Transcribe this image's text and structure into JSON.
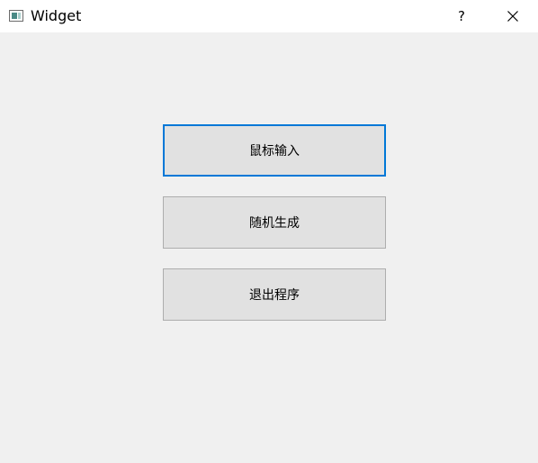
{
  "window": {
    "title": "Widget",
    "help_label": "?"
  },
  "buttons": [
    {
      "label": "鼠标输入"
    },
    {
      "label": "随机生成"
    },
    {
      "label": "退出程序"
    }
  ],
  "icons": {
    "app": "app-window-icon",
    "close": "close-icon"
  },
  "colors": {
    "focus_border": "#0078d7",
    "button_bg": "#e1e1e1",
    "window_bg": "#f0f0f0"
  }
}
